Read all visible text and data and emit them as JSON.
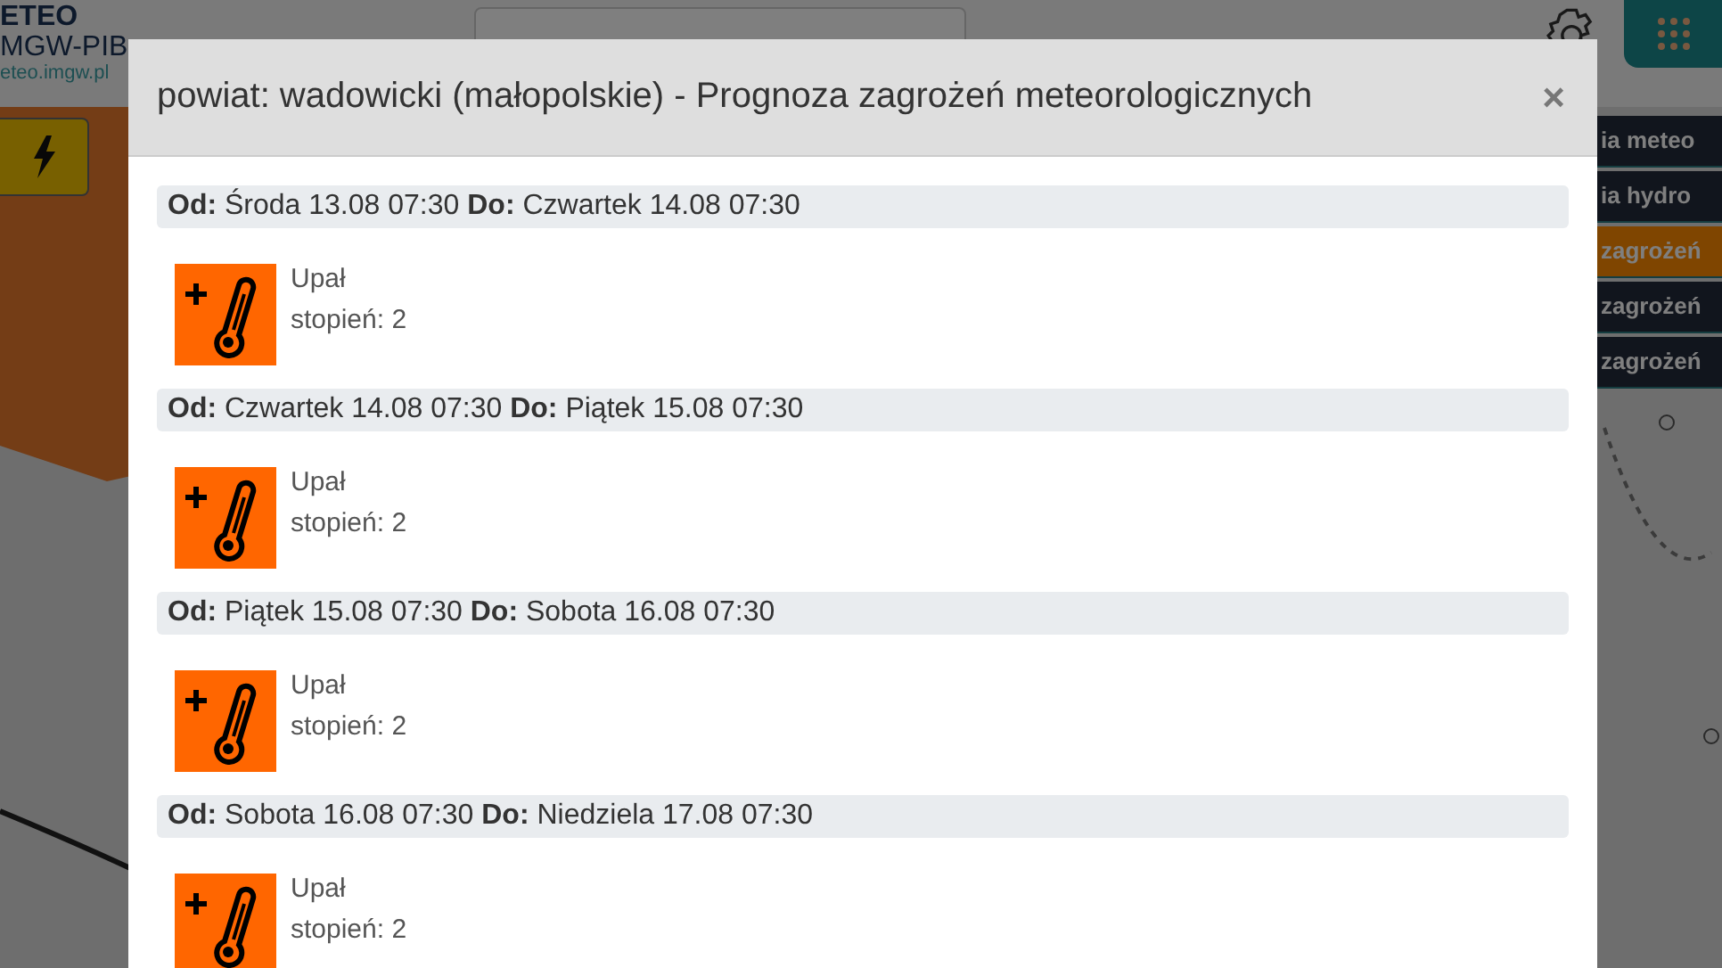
{
  "header": {
    "logo_lines": [
      "ETEO",
      "MGW-PIB"
    ],
    "site_link": "eteo.imgw.pl"
  },
  "side_menu": [
    {
      "label": "ia meteo",
      "selected": false
    },
    {
      "label": "ia hydro",
      "selected": false
    },
    {
      "label": "zagrożeń",
      "selected": true
    },
    {
      "label": "zagrożeń",
      "selected": false
    },
    {
      "label": "zagrożeń",
      "selected": false
    }
  ],
  "modal": {
    "title": "powiat: wadowicki (małopolskie) - Prognoza zagrożeń meteorologicznych",
    "close": "×",
    "warnings": [
      {
        "from_label": "Od:",
        "from": "Środa 13.08 07:30",
        "to_label": "Do:",
        "to": "Czwartek 14.08 07:30",
        "name": "Upał",
        "level": "stopień: 2"
      },
      {
        "from_label": "Od:",
        "from": "Czwartek 14.08 07:30",
        "to_label": "Do:",
        "to": "Piątek 15.08 07:30",
        "name": "Upał",
        "level": "stopień: 2"
      },
      {
        "from_label": "Od:",
        "from": "Piątek 15.08 07:30",
        "to_label": "Do:",
        "to": "Sobota 16.08 07:30",
        "name": "Upał",
        "level": "stopień: 2"
      },
      {
        "from_label": "Od:",
        "from": "Sobota 16.08 07:30",
        "to_label": "Do:",
        "to": "Niedziela 17.08 07:30",
        "name": "Upał",
        "level": "stopień: 2"
      }
    ]
  }
}
